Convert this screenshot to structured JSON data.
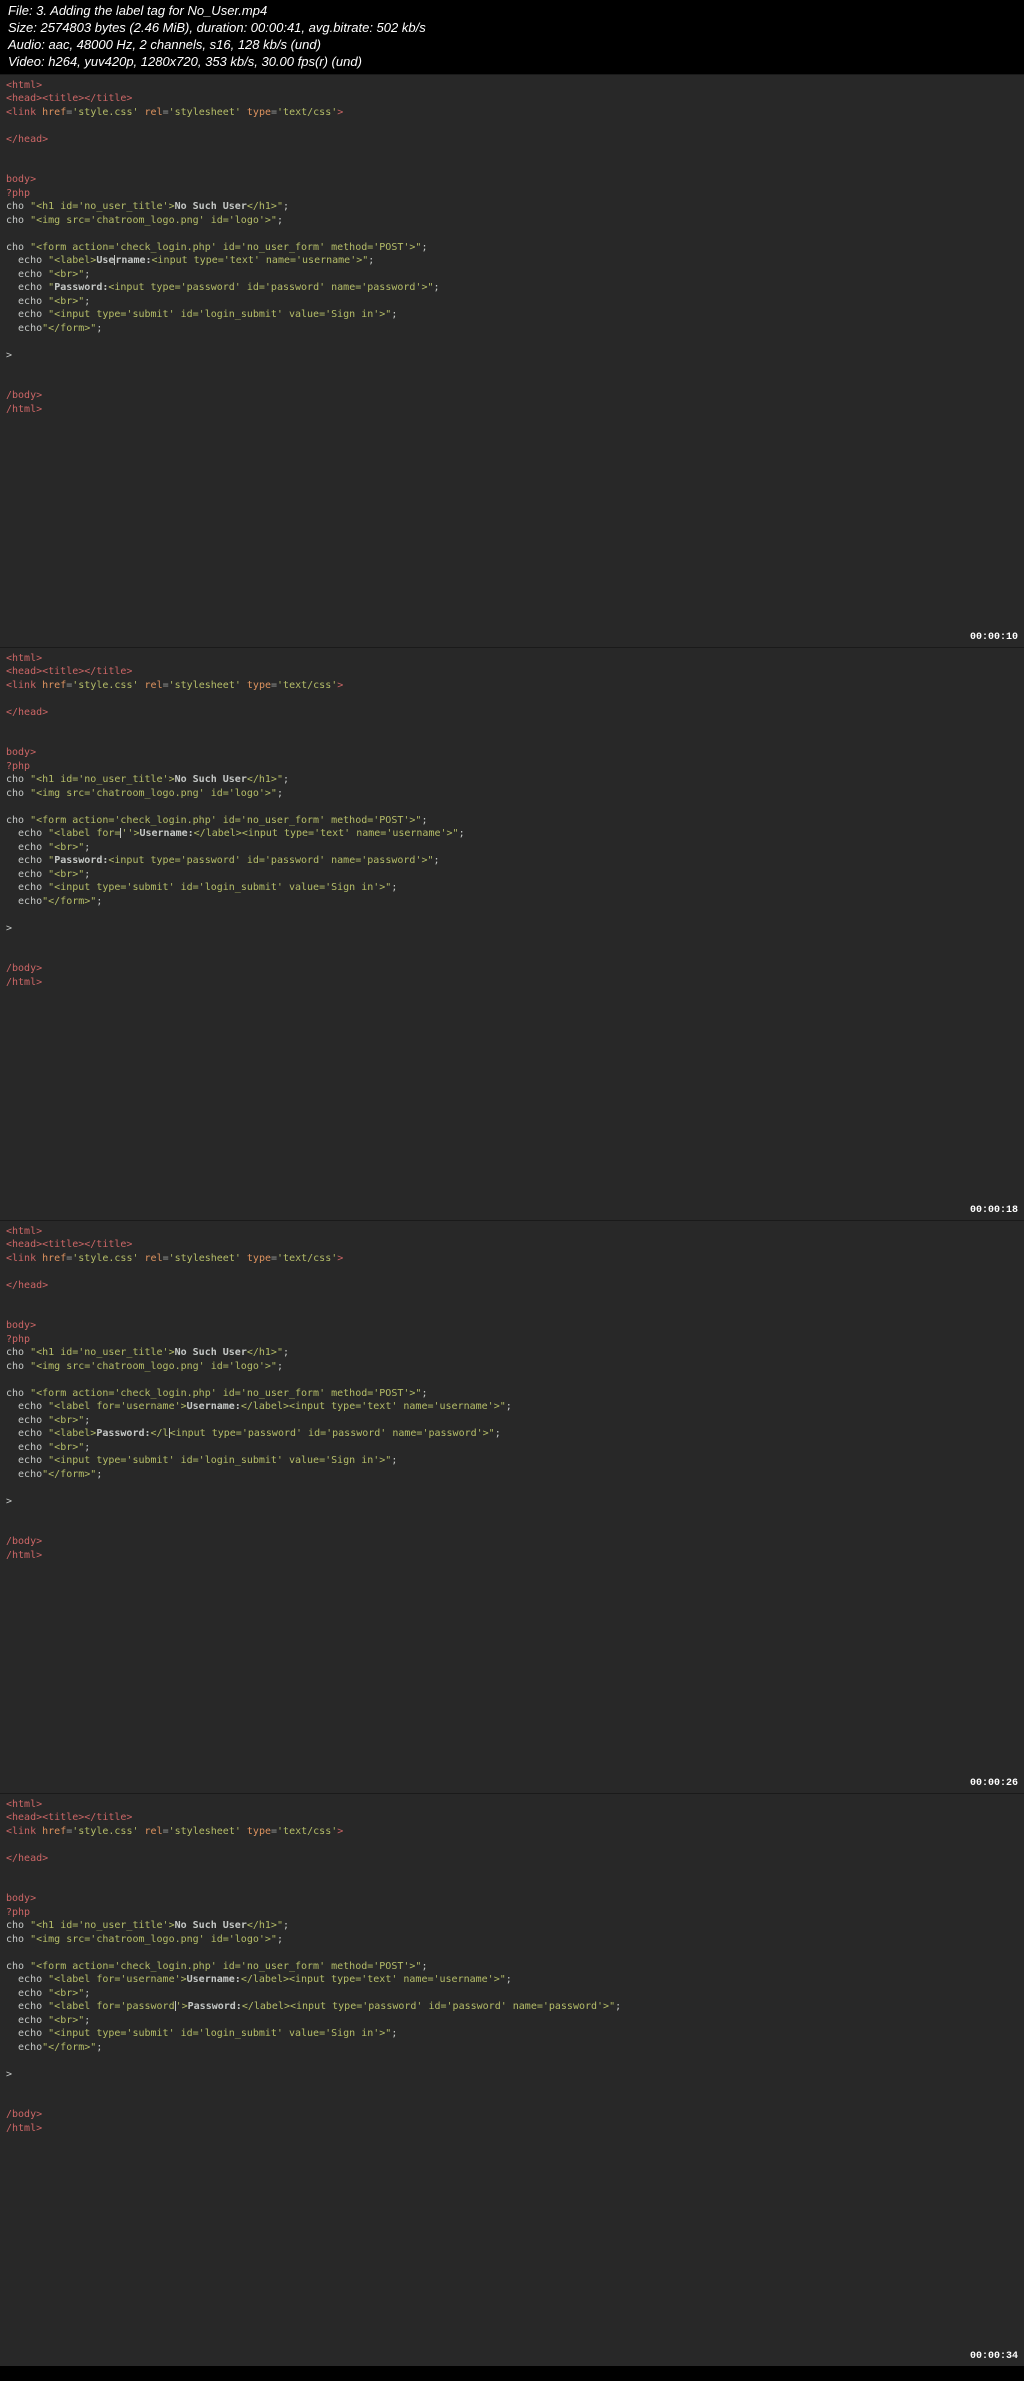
{
  "header": {
    "file_label": "File: ",
    "file_value": "3. Adding the label tag for No_User.mp4",
    "size_label": "Size: ",
    "size_value": "2574803 bytes (2.46 MiB), duration: 00:00:41, avg.bitrate: 502 kb/s",
    "audio_label": "Audio: ",
    "audio_value": "aac, 48000 Hz, 2 channels, s16, 128 kb/s (und)",
    "video_label": "Video: ",
    "video_value": "h264, yuv420p, 1280x720, 353 kb/s, 30.00 fps(r) (und)"
  },
  "frames": [
    {
      "timestamp": "00:00:10",
      "code_variant": 1
    },
    {
      "timestamp": "00:00:18",
      "code_variant": 2
    },
    {
      "timestamp": "00:00:26",
      "code_variant": 3
    },
    {
      "timestamp": "00:00:34",
      "code_variant": 4
    }
  ],
  "code_lines": {
    "common_head": [
      "<html>",
      "<head><title></title>",
      "<link href='style.css' rel='stylesheet' type='text/css'>",
      "",
      "</head>",
      "",
      "",
      "body>",
      "?php",
      "cho \"<h1 id='no_user_title'>No Such User</h1>\";",
      "cho \"<img src='chatroom_logo.png' id='logo'>\";",
      "",
      "cho \"<form action='check_login.php' id='no_user_form' method='POST'>\";"
    ],
    "variant1_form": [
      "  echo \"<label>Use|rname:<input type='text' name='username'>\";",
      "  echo \"<br>\";",
      "  echo \"Password:<input type='password' id='password' name='password'>\";",
      "  echo \"<br>\";",
      "  echo \"<input type='submit' id='login_submit' value='Sign in'>\";",
      "  echo\"</form>\";"
    ],
    "variant2_form": [
      "  echo \"<label for=|''>Username:</label><input type='text' name='username'>\";",
      "  echo \"<br>\";",
      "  echo \"Password:<input type='password' id='password' name='password'>\";",
      "  echo \"<br>\";",
      "  echo \"<input type='submit' id='login_submit' value='Sign in'>\";",
      "  echo\"</form>\";"
    ],
    "variant3_form": [
      "  echo \"<label for='username'>Username:</label><input type='text' name='username'>\";",
      "  echo \"<br>\";",
      "  echo \"<label>Password:</l|<input type='password' id='password' name='password'>\";",
      "  echo \"<br>\";",
      "  echo \"<input type='submit' id='login_submit' value='Sign in'>\";",
      "  echo\"</form>\";"
    ],
    "variant4_form": [
      "  echo \"<label for='username'>Username:</label><input type='text' name='username'>\";",
      "  echo \"<br>\";",
      "  echo \"<label for='password|'>Password:</label><input type='password' id='password' name='password'>\";",
      "  echo \"<br>\";",
      "  echo \"<input type='submit' id='login_submit' value='Sign in'>\";",
      "  echo\"</form>\";"
    ],
    "common_tail": [
      "",
      ">",
      "",
      "",
      "/body>",
      "/html>"
    ]
  }
}
